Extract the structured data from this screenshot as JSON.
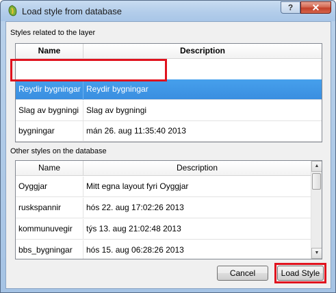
{
  "window": {
    "title": "Load style from database",
    "help_glyph": "?",
    "close_glyph": "✕"
  },
  "related": {
    "label": "Styles related to the layer",
    "columns": [
      "Name",
      "Description"
    ],
    "rows": [
      {
        "name": "Reydir bygningar",
        "description": "Reydir bygningar",
        "selected": true
      },
      {
        "name": "Slag av bygningi",
        "description": "Slag av bygningi",
        "selected": false
      },
      {
        "name": "bygningar",
        "description": "mán 26. aug 11:35:40 2013",
        "selected": false
      }
    ]
  },
  "other": {
    "label": "Other styles on the database",
    "columns": [
      "Name",
      "Description"
    ],
    "rows": [
      {
        "name": "Oyggjar",
        "description": "Mitt egna layout fyri Oyggjar"
      },
      {
        "name": "ruskspannir",
        "description": "hós 22. aug 17:02:26 2013"
      },
      {
        "name": "kommunuvegir",
        "description": "týs 13. aug 21:02:48 2013"
      },
      {
        "name": "bbs_bygningar",
        "description": "hós 15. aug 06:28:26 2013"
      }
    ]
  },
  "buttons": {
    "cancel": "Cancel",
    "load_style": "Load Style"
  },
  "colors": {
    "selection": "#3a8ee0",
    "highlight": "#e0121e"
  },
  "icons": {
    "app": "qgis-icon",
    "scroll_up": "scroll-up-arrow-icon",
    "scroll_down": "scroll-down-arrow-icon"
  }
}
